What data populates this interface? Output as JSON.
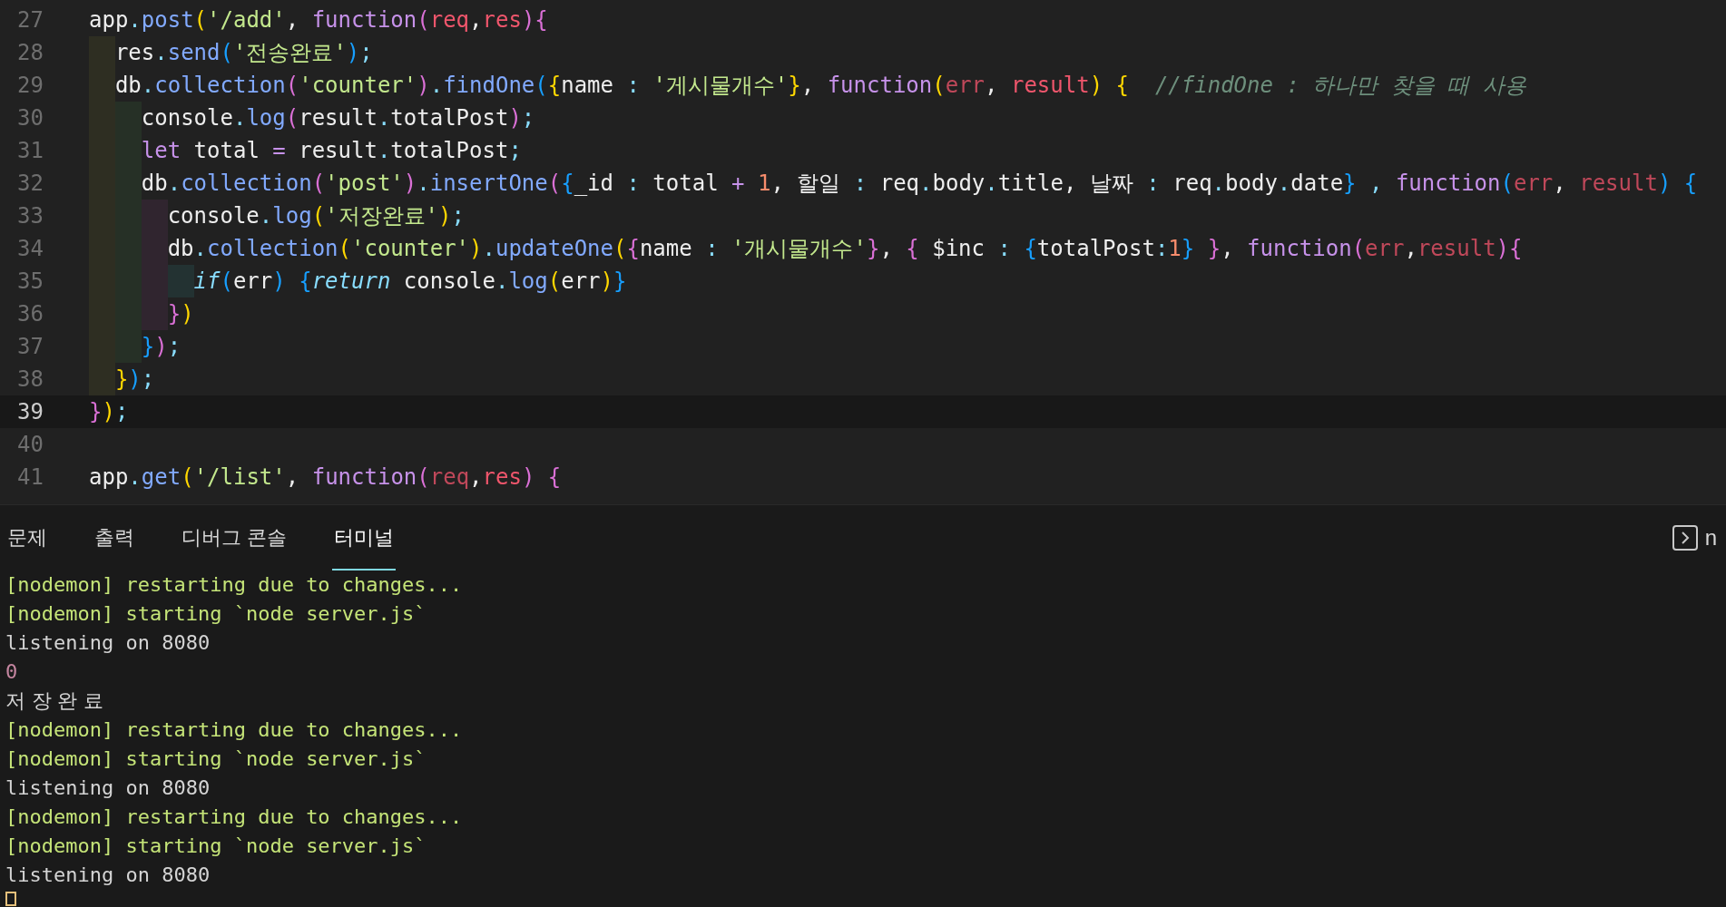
{
  "editor": {
    "lines": [
      {
        "number": "27",
        "current": false,
        "tokens": [
          {
            "kind": "p",
            "text": "app"
          },
          {
            "kind": "d",
            "text": "."
          },
          {
            "kind": "m",
            "text": "post"
          },
          {
            "kind": "y1",
            "text": "("
          },
          {
            "kind": "s",
            "text": "'/add'"
          },
          {
            "kind": "p",
            "text": ", "
          },
          {
            "kind": "f",
            "text": "function"
          },
          {
            "kind": "y2",
            "text": "("
          },
          {
            "kind": "a",
            "text": "req"
          },
          {
            "kind": "p",
            "text": ","
          },
          {
            "kind": "a",
            "text": "res"
          },
          {
            "kind": "y2",
            "text": ")"
          },
          {
            "kind": "y2",
            "text": "{"
          }
        ]
      },
      {
        "number": "28",
        "current": false,
        "tokens": [
          {
            "kind": "p",
            "text": "  res"
          },
          {
            "kind": "d",
            "text": "."
          },
          {
            "kind": "m",
            "text": "send"
          },
          {
            "kind": "y3",
            "text": "("
          },
          {
            "kind": "s",
            "text": "'전송완료'"
          },
          {
            "kind": "y3",
            "text": ")"
          },
          {
            "kind": "d",
            "text": ";"
          }
        ]
      },
      {
        "number": "29",
        "current": false,
        "tokens": [
          {
            "kind": "p",
            "text": "  db"
          },
          {
            "kind": "d",
            "text": "."
          },
          {
            "kind": "m",
            "text": "collection"
          },
          {
            "kind": "y2",
            "text": "("
          },
          {
            "kind": "s",
            "text": "'counter'"
          },
          {
            "kind": "y2",
            "text": ")"
          },
          {
            "kind": "d",
            "text": "."
          },
          {
            "kind": "m",
            "text": "findOne"
          },
          {
            "kind": "y3",
            "text": "("
          },
          {
            "kind": "y1",
            "text": "{"
          },
          {
            "kind": "p",
            "text": "name "
          },
          {
            "kind": "d",
            "text": ": "
          },
          {
            "kind": "s",
            "text": "'게시물개수'"
          },
          {
            "kind": "y1",
            "text": "}"
          },
          {
            "kind": "p",
            "text": ", "
          },
          {
            "kind": "f",
            "text": "function"
          },
          {
            "kind": "y1",
            "text": "("
          },
          {
            "kind": "b",
            "text": "err"
          },
          {
            "kind": "p",
            "text": ", "
          },
          {
            "kind": "a",
            "text": "result"
          },
          {
            "kind": "y1",
            "text": ")"
          },
          {
            "kind": "y1",
            "text": " {"
          },
          {
            "kind": "c",
            "text": "  //findOne : 하나만 찾을 때 사용"
          }
        ]
      },
      {
        "number": "30",
        "current": false,
        "tokens": [
          {
            "kind": "p",
            "text": "    console"
          },
          {
            "kind": "d",
            "text": "."
          },
          {
            "kind": "m",
            "text": "log"
          },
          {
            "kind": "y2",
            "text": "("
          },
          {
            "kind": "p",
            "text": "result"
          },
          {
            "kind": "d",
            "text": "."
          },
          {
            "kind": "p",
            "text": "totalPost"
          },
          {
            "kind": "y2",
            "text": ")"
          },
          {
            "kind": "d",
            "text": ";"
          }
        ]
      },
      {
        "number": "31",
        "current": false,
        "tokens": [
          {
            "kind": "f",
            "text": "    let"
          },
          {
            "kind": "p",
            "text": " total "
          },
          {
            "kind": "o",
            "text": "="
          },
          {
            "kind": "p",
            "text": " result"
          },
          {
            "kind": "d",
            "text": "."
          },
          {
            "kind": "p",
            "text": "totalPost"
          },
          {
            "kind": "d",
            "text": ";"
          }
        ]
      },
      {
        "number": "32",
        "current": false,
        "tokens": [
          {
            "kind": "p",
            "text": "    db"
          },
          {
            "kind": "d",
            "text": "."
          },
          {
            "kind": "m",
            "text": "collection"
          },
          {
            "kind": "y2",
            "text": "("
          },
          {
            "kind": "s",
            "text": "'post'"
          },
          {
            "kind": "y2",
            "text": ")"
          },
          {
            "kind": "d",
            "text": "."
          },
          {
            "kind": "m",
            "text": "insertOne"
          },
          {
            "kind": "y2",
            "text": "("
          },
          {
            "kind": "y3",
            "text": "{"
          },
          {
            "kind": "p",
            "text": "_id "
          },
          {
            "kind": "d",
            "text": ":"
          },
          {
            "kind": "p",
            "text": " total "
          },
          {
            "kind": "o",
            "text": "+ "
          },
          {
            "kind": "n",
            "text": "1"
          },
          {
            "kind": "p",
            "text": ", 할일 "
          },
          {
            "kind": "d",
            "text": ":"
          },
          {
            "kind": "p",
            "text": " req"
          },
          {
            "kind": "d",
            "text": "."
          },
          {
            "kind": "p",
            "text": "body"
          },
          {
            "kind": "d",
            "text": "."
          },
          {
            "kind": "p",
            "text": "title"
          },
          {
            "kind": "p",
            "text": ", 날짜 "
          },
          {
            "kind": "d",
            "text": ":"
          },
          {
            "kind": "p",
            "text": " req"
          },
          {
            "kind": "d",
            "text": "."
          },
          {
            "kind": "p",
            "text": "body"
          },
          {
            "kind": "d",
            "text": "."
          },
          {
            "kind": "p",
            "text": "date"
          },
          {
            "kind": "y3",
            "text": "}"
          },
          {
            "kind": "d",
            "text": " , "
          },
          {
            "kind": "f",
            "text": "function"
          },
          {
            "kind": "y3",
            "text": "("
          },
          {
            "kind": "b",
            "text": "err"
          },
          {
            "kind": "p",
            "text": ", "
          },
          {
            "kind": "b",
            "text": "result"
          },
          {
            "kind": "y3",
            "text": ") {"
          }
        ]
      },
      {
        "number": "33",
        "current": false,
        "tokens": [
          {
            "kind": "p",
            "text": "      console"
          },
          {
            "kind": "d",
            "text": "."
          },
          {
            "kind": "m",
            "text": "log"
          },
          {
            "kind": "y1",
            "text": "("
          },
          {
            "kind": "s",
            "text": "'저장완료'"
          },
          {
            "kind": "y1",
            "text": ")"
          },
          {
            "kind": "d",
            "text": ";"
          }
        ]
      },
      {
        "number": "34",
        "current": false,
        "tokens": [
          {
            "kind": "p",
            "text": "      db"
          },
          {
            "kind": "d",
            "text": "."
          },
          {
            "kind": "m",
            "text": "collection"
          },
          {
            "kind": "y1",
            "text": "("
          },
          {
            "kind": "s",
            "text": "'counter'"
          },
          {
            "kind": "y1",
            "text": ")"
          },
          {
            "kind": "d",
            "text": "."
          },
          {
            "kind": "m",
            "text": "updateOne"
          },
          {
            "kind": "y1",
            "text": "("
          },
          {
            "kind": "y2",
            "text": "{"
          },
          {
            "kind": "p",
            "text": "name "
          },
          {
            "kind": "d",
            "text": ": "
          },
          {
            "kind": "s",
            "text": "'개시물개수'"
          },
          {
            "kind": "y2",
            "text": "}"
          },
          {
            "kind": "p",
            "text": ", "
          },
          {
            "kind": "y2",
            "text": "{"
          },
          {
            "kind": "p",
            "text": " $inc "
          },
          {
            "kind": "d",
            "text": ": "
          },
          {
            "kind": "y3",
            "text": "{"
          },
          {
            "kind": "p",
            "text": "totalPost"
          },
          {
            "kind": "d",
            "text": ":"
          },
          {
            "kind": "n",
            "text": "1"
          },
          {
            "kind": "y3",
            "text": "}"
          },
          {
            "kind": "y2",
            "text": " }"
          },
          {
            "kind": "p",
            "text": ", "
          },
          {
            "kind": "f",
            "text": "function"
          },
          {
            "kind": "y2",
            "text": "("
          },
          {
            "kind": "b",
            "text": "err"
          },
          {
            "kind": "p",
            "text": ","
          },
          {
            "kind": "b",
            "text": "result"
          },
          {
            "kind": "y2",
            "text": ")"
          },
          {
            "kind": "y2",
            "text": "{"
          }
        ]
      },
      {
        "number": "35",
        "current": false,
        "tokens": [
          {
            "kind": "i",
            "text": "        if"
          },
          {
            "kind": "y3",
            "text": "("
          },
          {
            "kind": "p",
            "text": "err"
          },
          {
            "kind": "y3",
            "text": ") {"
          },
          {
            "kind": "i",
            "text": "return"
          },
          {
            "kind": "p",
            "text": " console"
          },
          {
            "kind": "d",
            "text": "."
          },
          {
            "kind": "m",
            "text": "log"
          },
          {
            "kind": "y1",
            "text": "("
          },
          {
            "kind": "p",
            "text": "err"
          },
          {
            "kind": "y1",
            "text": ")"
          },
          {
            "kind": "y3",
            "text": "}"
          }
        ]
      },
      {
        "number": "36",
        "current": false,
        "tokens": [
          {
            "kind": "y2",
            "text": "      }"
          },
          {
            "kind": "y1",
            "text": ")"
          }
        ]
      },
      {
        "number": "37",
        "current": false,
        "tokens": [
          {
            "kind": "y3",
            "text": "    }"
          },
          {
            "kind": "y2",
            "text": ")"
          },
          {
            "kind": "d",
            "text": ";"
          }
        ]
      },
      {
        "number": "38",
        "current": false,
        "tokens": [
          {
            "kind": "y1",
            "text": "  }"
          },
          {
            "kind": "y3",
            "text": ")"
          },
          {
            "kind": "d",
            "text": ";"
          }
        ]
      },
      {
        "number": "39",
        "current": true,
        "tokens": [
          {
            "kind": "y2",
            "text": "}"
          },
          {
            "kind": "y1",
            "text": ")"
          },
          {
            "kind": "d",
            "text": ";"
          }
        ]
      },
      {
        "number": "40",
        "current": false
      },
      {
        "number": "41",
        "current": false,
        "tokens": [
          {
            "kind": "p",
            "text": "app"
          },
          {
            "kind": "d",
            "text": "."
          },
          {
            "kind": "m",
            "text": "get"
          },
          {
            "kind": "y1",
            "text": "("
          },
          {
            "kind": "s",
            "text": "'/list'"
          },
          {
            "kind": "p",
            "text": ", "
          },
          {
            "kind": "f",
            "text": "function"
          },
          {
            "kind": "y2",
            "text": "("
          },
          {
            "kind": "b",
            "text": "req"
          },
          {
            "kind": "p",
            "text": ","
          },
          {
            "kind": "a",
            "text": "res"
          },
          {
            "kind": "y2",
            "text": ") {"
          }
        ]
      }
    ]
  },
  "panel": {
    "tabs": [
      {
        "label": "문제",
        "selected": false
      },
      {
        "label": "출력",
        "selected": false
      },
      {
        "label": "디버그 콘솔",
        "selected": false
      },
      {
        "label": "터미널",
        "selected": true
      }
    ],
    "terminal_name": "n",
    "terminal": [
      {
        "kind": "nodemon",
        "text": "[nodemon] restarting due to changes..."
      },
      {
        "kind": "nodemon",
        "text": "[nodemon] starting `node server.js`"
      },
      {
        "kind": "log",
        "text": "listening on 8080"
      },
      {
        "kind": "number",
        "text": "0"
      },
      {
        "kind": "korean",
        "text": "저장완료"
      },
      {
        "kind": "nodemon",
        "text": "[nodemon] restarting due to changes..."
      },
      {
        "kind": "nodemon",
        "text": "[nodemon] starting `node server.js`"
      },
      {
        "kind": "log",
        "text": "listening on 8080"
      },
      {
        "kind": "nodemon",
        "text": "[nodemon] restarting due to changes..."
      },
      {
        "kind": "nodemon",
        "text": "[nodemon] starting `node server.js`"
      },
      {
        "kind": "log",
        "text": "listening on 8080"
      }
    ]
  }
}
